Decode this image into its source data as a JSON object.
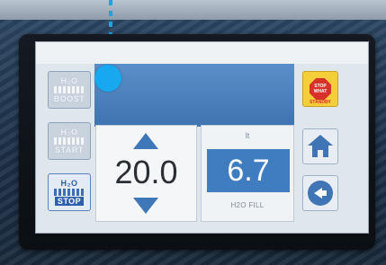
{
  "left_buttons": [
    {
      "line1": "H₂O",
      "line2": "BOOST",
      "state": "disabled"
    },
    {
      "line1": "H₂O",
      "line2": "START",
      "state": "disabled"
    },
    {
      "line1": "H₂O",
      "line2": "STOP",
      "state": "active"
    }
  ],
  "setpoint": {
    "value": "20.0"
  },
  "reading": {
    "unit": "lt",
    "value": "6.7",
    "caption": "H2O FILL"
  },
  "right_buttons": {
    "standby": {
      "sign_line1": "STOP",
      "sign_line2": "WHAT",
      "label": "STANDBY",
      "icon": "stop-sign-icon"
    },
    "home": {
      "icon": "home-icon"
    },
    "back": {
      "icon": "back-arrow-icon"
    }
  },
  "colors": {
    "accent_blue": "#3f7dc0",
    "indicator_dot": "#18a8ef",
    "standby_yellow": "#f4cf3a",
    "stop_red": "#d8312a"
  }
}
